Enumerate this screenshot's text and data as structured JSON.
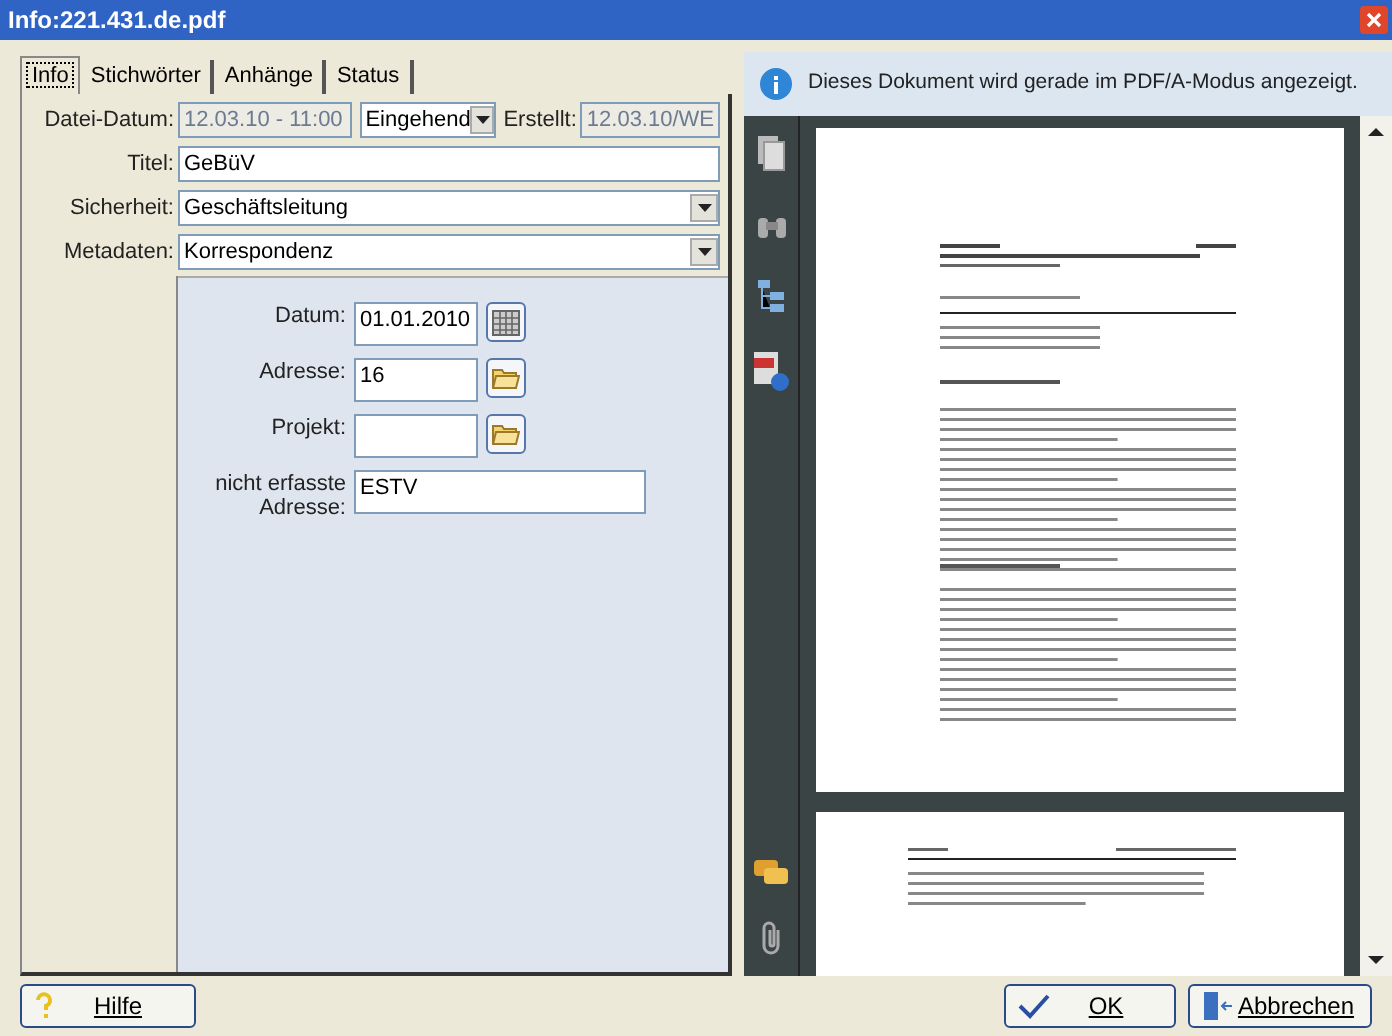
{
  "window": {
    "title": "Info:221.431.de.pdf"
  },
  "tabs": [
    {
      "label": "Info",
      "selected": true
    },
    {
      "label": "Stichwörter",
      "selected": false
    },
    {
      "label": "Anhänge",
      "selected": false
    },
    {
      "label": "Status",
      "selected": false
    }
  ],
  "info": {
    "file_date_label": "Datei-Datum:",
    "file_date": "12.03.10 - 11:00",
    "direction": "Eingehend",
    "created_label": "Erstellt:",
    "created": "12.03.10/WE",
    "title_label": "Titel:",
    "title": "GeBüV",
    "security_label": "Sicherheit:",
    "security": "Geschäftsleitung",
    "metadata_label": "Metadaten:",
    "metadata": "Korrespondenz"
  },
  "metadata_fields": [
    {
      "label": "Datum:",
      "value": "01.01.2010",
      "kind": "date"
    },
    {
      "label": "Adresse:",
      "value": "16",
      "kind": "folder"
    },
    {
      "label": "Projekt:",
      "kind": "folder"
    },
    {
      "label": "nicht erfasste Adresse:",
      "value": "ESTV",
      "kind": "text"
    }
  ],
  "viewer": {
    "notice": "Dieses Dokument wird gerade im PDF/A-Modus angezeigt."
  },
  "buttons": [
    {
      "label": "Hilfe",
      "kind": "help"
    },
    {
      "label": "OK",
      "kind": "ok"
    },
    {
      "label": "Abbrechen",
      "kind": "cancel"
    }
  ]
}
